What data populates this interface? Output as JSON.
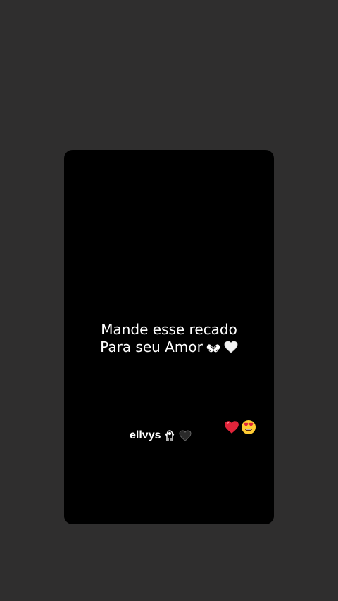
{
  "story": {
    "caption_line1": "Mande esse recado",
    "caption_line2": "Para seu Amor",
    "caption_emojis": [
      "heart-hands-icon",
      "white-heart-icon"
    ],
    "username": "ellvys",
    "username_emojis": [
      "woman-gesturing-icon",
      "black-heart-icon"
    ],
    "reactions": [
      "red-heart-icon",
      "heart-eyes-face-icon"
    ]
  },
  "colors": {
    "page_background": "#2f2e2e",
    "card_background": "#000000",
    "text": "#ffffff",
    "red_heart": "#e0243a",
    "emoji_yellow": "#ffcc33"
  }
}
